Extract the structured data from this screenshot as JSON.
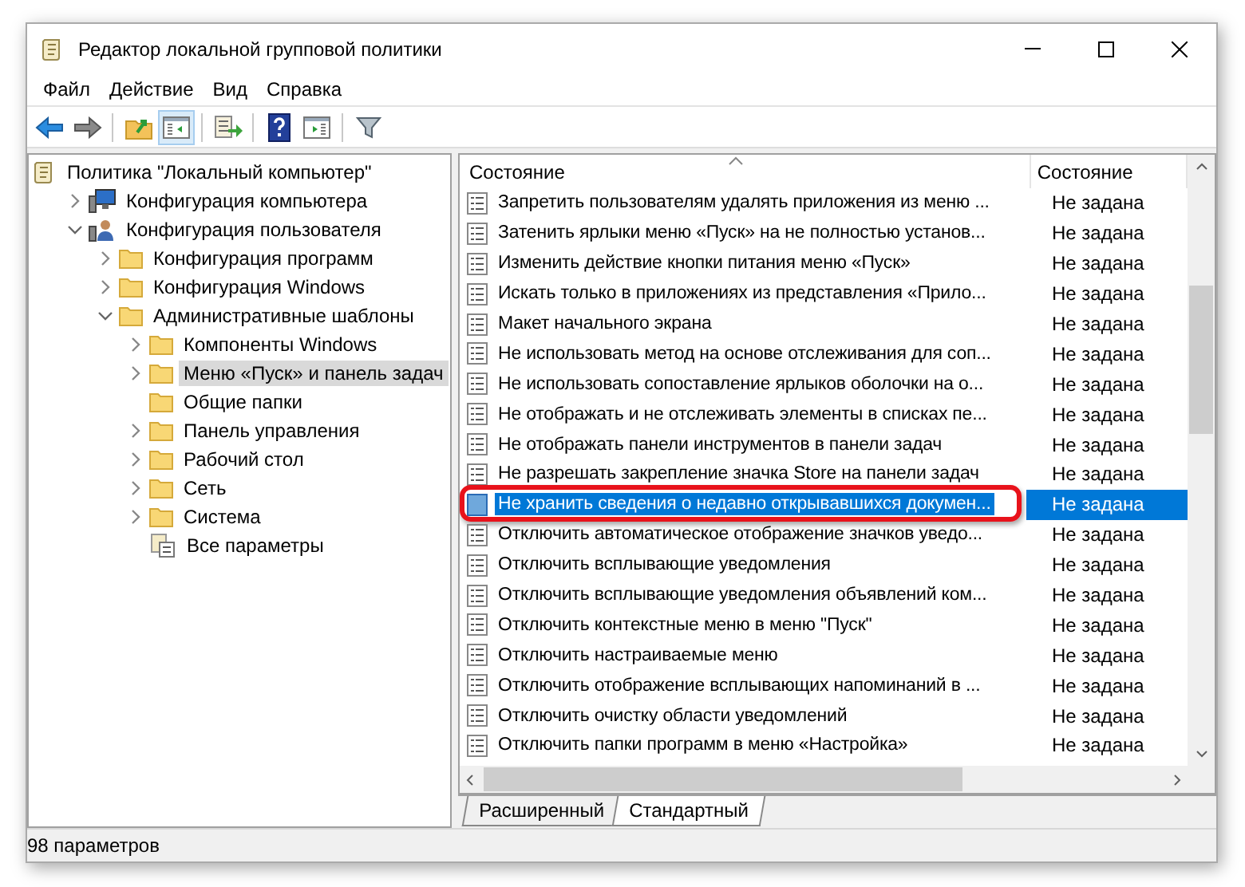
{
  "window": {
    "title": "Редактор локальной групповой политики"
  },
  "menu": [
    "Файл",
    "Действие",
    "Вид",
    "Справка"
  ],
  "toolbar": [
    {
      "kind": "back",
      "pressed": false
    },
    {
      "kind": "forward",
      "pressed": false
    },
    {
      "kind": "sep"
    },
    {
      "kind": "up",
      "pressed": false
    },
    {
      "kind": "tree",
      "pressed": true
    },
    {
      "kind": "sep"
    },
    {
      "kind": "export",
      "pressed": false
    },
    {
      "kind": "sep"
    },
    {
      "kind": "help",
      "pressed": false
    },
    {
      "kind": "pane",
      "pressed": false
    },
    {
      "kind": "sep"
    },
    {
      "kind": "filter",
      "pressed": false
    }
  ],
  "tree": [
    {
      "label": "Политика \"Локальный компьютер\"",
      "kind": "policy",
      "selected": false,
      "children": [
        {
          "label": "Конфигурация компьютера",
          "kind": "computer",
          "expanded": false,
          "selected": false
        },
        {
          "label": "Конфигурация пользователя",
          "kind": "user",
          "expanded": true,
          "selected": false,
          "children": [
            {
              "label": "Конфигурация программ",
              "kind": "folder",
              "expanded": false,
              "selected": false
            },
            {
              "label": "Конфигурация Windows",
              "kind": "folder",
              "expanded": false,
              "selected": false
            },
            {
              "label": "Административные шаблоны",
              "kind": "folder",
              "expanded": true,
              "selected": false,
              "children": [
                {
                  "label": "Компоненты Windows",
                  "kind": "folder",
                  "expanded": false,
                  "selected": false
                },
                {
                  "label": "Меню «Пуск» и панель задач",
                  "kind": "folder",
                  "expanded": false,
                  "selected": true
                },
                {
                  "label": "Общие папки",
                  "kind": "folder",
                  "selected": false
                },
                {
                  "label": "Панель управления",
                  "kind": "folder",
                  "expanded": false,
                  "selected": false
                },
                {
                  "label": "Рабочий стол",
                  "kind": "folder",
                  "expanded": false,
                  "selected": false
                },
                {
                  "label": "Сеть",
                  "kind": "folder",
                  "expanded": false,
                  "selected": false
                },
                {
                  "label": "Система",
                  "kind": "folder",
                  "expanded": false,
                  "selected": false
                },
                {
                  "label": "Все параметры",
                  "kind": "all-settings",
                  "selected": false
                }
              ]
            }
          ]
        }
      ]
    }
  ],
  "table": {
    "columns": [
      "Состояние",
      "Состояние"
    ],
    "rows": [
      {
        "name": "Запретить пользователям удалять приложения из меню ...",
        "state": "Не задана",
        "selected": false,
        "highlighted": false
      },
      {
        "name": "Затенить ярлыки меню «Пуск» на не полностью установ...",
        "state": "Не задана",
        "selected": false,
        "highlighted": false
      },
      {
        "name": "Изменить действие кнопки питания меню «Пуск»",
        "state": "Не задана",
        "selected": false,
        "highlighted": false
      },
      {
        "name": "Искать только в приложениях из представления «Прило...",
        "state": "Не задана",
        "selected": false,
        "highlighted": false
      },
      {
        "name": "Макет начального экрана",
        "state": "Не задана",
        "selected": false,
        "highlighted": false
      },
      {
        "name": "Не использовать метод на основе отслеживания для соп...",
        "state": "Не задана",
        "selected": false,
        "highlighted": false
      },
      {
        "name": "Не использовать сопоставление ярлыков оболочки на о...",
        "state": "Не задана",
        "selected": false,
        "highlighted": false
      },
      {
        "name": "Не отображать и не отслеживать элементы в списках пе...",
        "state": "Не задана",
        "selected": false,
        "highlighted": false
      },
      {
        "name": "Не отображать панели инструментов в панели задач",
        "state": "Не задана",
        "selected": false,
        "highlighted": false
      },
      {
        "name": "Не разрешать закрепление значка Store на панели задач",
        "state": "Не задана",
        "selected": false,
        "highlighted": false
      },
      {
        "name": "Не хранить сведения о недавно открывавшихся докумен...",
        "state": "Не задана",
        "selected": true,
        "highlighted": true
      },
      {
        "name": "Отключить автоматическое отображение значков уведо...",
        "state": "Не задана",
        "selected": false,
        "highlighted": false
      },
      {
        "name": "Отключить всплывающие уведомления",
        "state": "Не задана",
        "selected": false,
        "highlighted": false
      },
      {
        "name": "Отключить всплывающие уведомления объявлений ком...",
        "state": "Не задана",
        "selected": false,
        "highlighted": false
      },
      {
        "name": "Отключить контекстные меню в меню \"Пуск\"",
        "state": "Не задана",
        "selected": false,
        "highlighted": false
      },
      {
        "name": "Отключить настраиваемые меню",
        "state": "Не задана",
        "selected": false,
        "highlighted": false
      },
      {
        "name": "Отключить отображение всплывающих напоминаний в ...",
        "state": "Не задана",
        "selected": false,
        "highlighted": false
      },
      {
        "name": "Отключить очистку области уведомлений",
        "state": "Не задана",
        "selected": false,
        "highlighted": false
      },
      {
        "name": "Отключить папки программ в меню «Настройка»",
        "state": "Не задана",
        "selected": false,
        "highlighted": false
      }
    ]
  },
  "view_tabs": [
    {
      "label": "Расширенный",
      "selected": false
    },
    {
      "label": "Стандартный",
      "selected": true
    }
  ],
  "status_bar": "98 параметров"
}
